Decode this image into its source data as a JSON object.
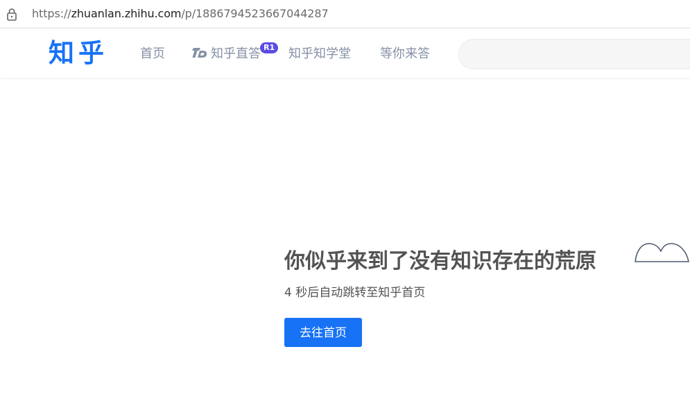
{
  "browser": {
    "url_prefix": "https://",
    "url_host": "zhuanlan.zhihu.com",
    "url_path": "/p/1886794523667044287"
  },
  "header": {
    "logo": "知乎",
    "nav": {
      "home": "首页",
      "live": "知乎直答",
      "live_badge": "R1",
      "school": "知乎知学堂",
      "waiting": "等你来答"
    },
    "search": {
      "placeholder": ""
    }
  },
  "main": {
    "title": "你似乎来到了没有知识存在的荒原",
    "countdown_seconds": "4",
    "countdown_text": "秒后自动跳转至知乎首页",
    "home_button": "去往首页"
  },
  "colors": {
    "brand": "#1772f6",
    "nav_text": "#8590a6",
    "badge": "#5b4ce6",
    "title_text": "#535353"
  },
  "icons": [
    "lock-icon",
    "zhida-logo-icon",
    "cloud-icon"
  ]
}
